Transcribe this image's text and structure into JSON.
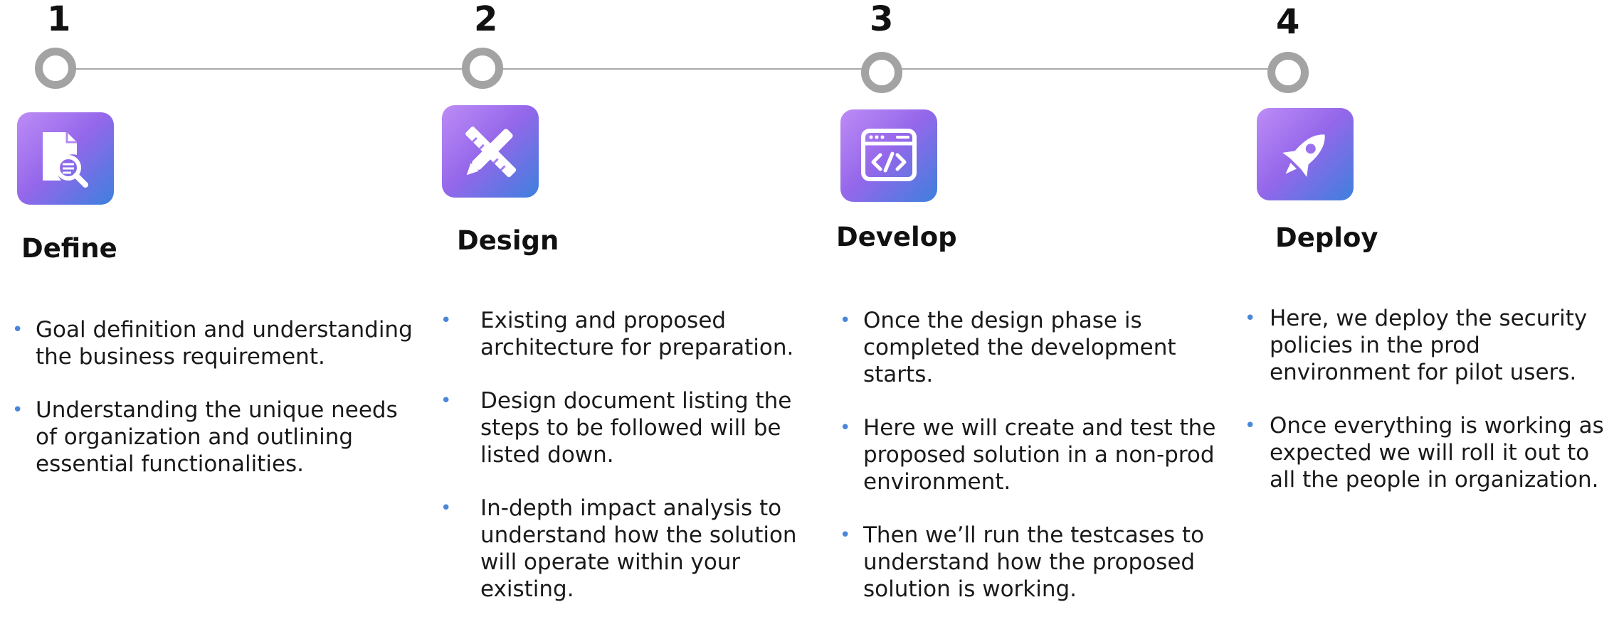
{
  "colors": {
    "timeline_line": "#a9a9a9",
    "node_ring": "#a3a3a3",
    "tile_gradient_start": "#bd8cf6",
    "tile_gradient_mid": "#9467ea",
    "tile_gradient_end": "#3d80dd",
    "bullet": "#4a86d8",
    "text": "#111111"
  },
  "steps": [
    {
      "number": "1",
      "icon": "document-search-icon",
      "title": "Define",
      "bullets": [
        "Goal definition and understanding the business requirement.",
        "Understanding the unique needs of organization and outlining essential functionalities."
      ]
    },
    {
      "number": "2",
      "icon": "pencil-ruler-icon",
      "title": "Design",
      "bullets": [
        "Existing and proposed architecture for preparation.",
        "Design document listing the steps to be followed will be listed down.",
        "In-depth impact analysis to understand how the solution will operate within your existing."
      ]
    },
    {
      "number": "3",
      "icon": "code-window-icon",
      "title": "Develop",
      "bullets": [
        "Once the design phase is completed the development starts.",
        "Here we will create and test the proposed solution in a non-prod environment.",
        "Then we’ll run the testcases to understand how the proposed solution is working."
      ]
    },
    {
      "number": "4",
      "icon": "rocket-icon",
      "title": "Deploy",
      "bullets": [
        "Here, we deploy the security policies in the prod environment for pilot users.",
        "Once everything is working as expected we will roll it out to all the people in organization."
      ]
    }
  ]
}
